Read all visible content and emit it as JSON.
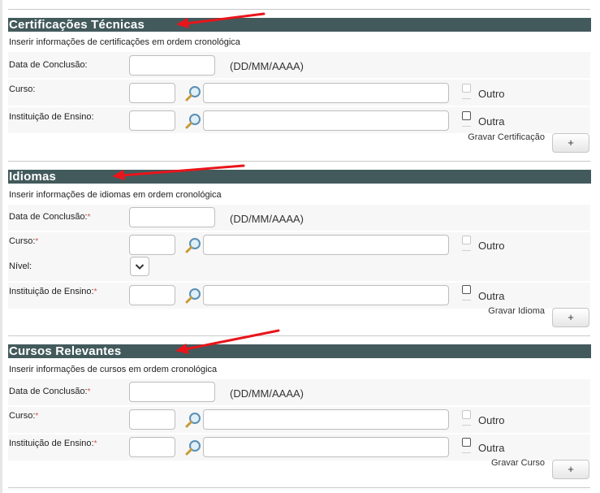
{
  "certificacoes": {
    "title": "Certificações Técnicas",
    "subtitle": "Inserir informações de certificações em ordem cronológica",
    "date_label": "Data de Conclusão:",
    "date_hint": "(DD/MM/AAAA)",
    "course_label": "Curso:",
    "course_other": "Outro",
    "institution_label": "Instituição de Ensino:",
    "institution_other": "Outra",
    "save_label": "Gravar Certificação",
    "add_button": "+"
  },
  "idiomas": {
    "title": "Idiomas",
    "subtitle": "Inserir informações de idiomas em ordem cronológica",
    "date_label": "Data de Conclusão:",
    "date_hint": "(DD/MM/AAAA)",
    "course_label": "Curso:",
    "course_other": "Outro",
    "level_label": "Nível:",
    "institution_label": "Instituição de Ensino:",
    "institution_other": "Outra",
    "save_label": "Gravar Idioma",
    "add_button": "+"
  },
  "cursos": {
    "title": "Cursos Relevantes",
    "subtitle": "Inserir informações de cursos em ordem cronológica",
    "date_label": "Data de Conclusão:",
    "date_hint": "(DD/MM/AAAA)",
    "course_label": "Curso:",
    "course_other": "Outro",
    "institution_label": "Instituição de Ensino:",
    "institution_other": "Outra",
    "save_label": "Gravar Curso",
    "add_button": "+"
  },
  "required_marker": "*",
  "colors": {
    "header_bg": "#435a5c",
    "annotation_arrow": "#e8151b",
    "required": "#d9534f"
  }
}
